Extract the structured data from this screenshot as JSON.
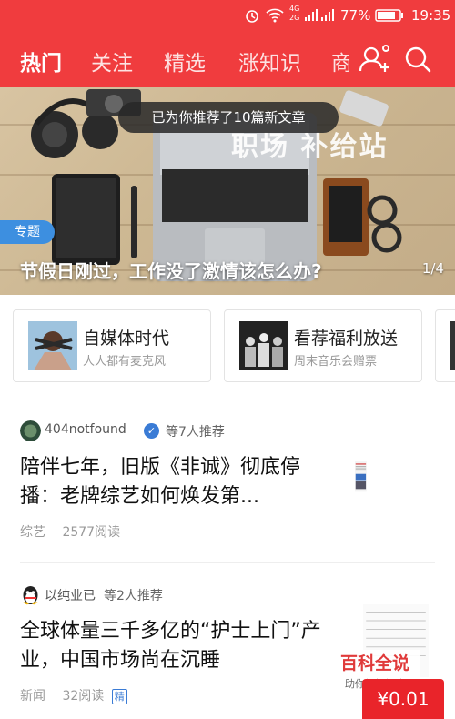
{
  "status": {
    "battery": "77%",
    "time": "19:35",
    "net1": "4G",
    "net2": "2G"
  },
  "nav": {
    "tabs": [
      {
        "label": "热门"
      },
      {
        "label": "关注"
      },
      {
        "label": "精选"
      },
      {
        "label": "涨知识"
      },
      {
        "label": "商"
      }
    ]
  },
  "banner": {
    "toast": "已为你推荐了10篇新文章",
    "overlay_text": "职场 补给站",
    "tag": "专题",
    "title": "节假日刚过，工作没了激情该怎么办?",
    "page": "1/4"
  },
  "cards": [
    {
      "title": "自媒体时代",
      "subtitle": "人人都有麦克风"
    },
    {
      "title": "看荐福利放送",
      "subtitle": "周末音乐会赠票"
    }
  ],
  "feed": [
    {
      "author": "404notfound",
      "recommend": "等7人推荐",
      "headline": "陪伴七年，旧版《非诚》彻底停播：老牌综艺如何焕发第...",
      "category": "综艺",
      "reads": "2577阅读"
    },
    {
      "author": "以纯业已",
      "recommend": "等2人推荐",
      "headline": "全球体量三千多亿的“护士上门”产业，中国市场尚在沉睡",
      "category": "新闻",
      "reads": "32阅读",
      "badge": "精"
    }
  ],
  "watermark": {
    "title": "百科全说",
    "subtitle": "助你轻松解决"
  },
  "price_button": "¥0.01",
  "colors": {
    "brand_red": "#f03c3e",
    "tag_blue": "#3d8fe0"
  }
}
